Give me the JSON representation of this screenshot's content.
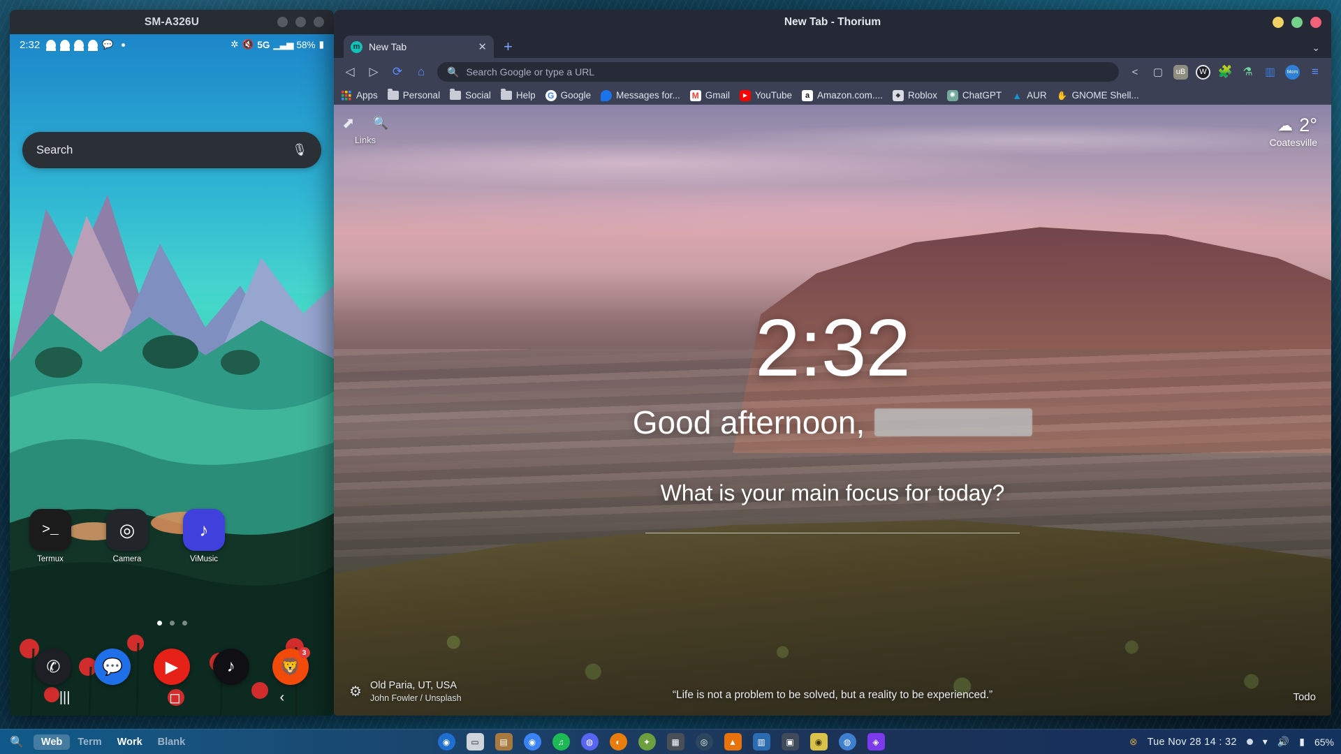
{
  "phone": {
    "window_title": "SM-A326U",
    "status_bar": {
      "time": "2:32",
      "notif_icons": [
        "ghost-icon",
        "ghost-icon",
        "ghost-icon",
        "ghost-icon",
        "chat-icon"
      ],
      "bluetooth": "bluetooth-icon",
      "mute": "ringer-off-icon",
      "network": "5G",
      "signal": "signal-bars-icon",
      "battery": "58%",
      "battery_icon": "battery-icon"
    },
    "search": {
      "placeholder": "Search",
      "mic_icon": "microphone-icon"
    },
    "apps": [
      {
        "label": "Termux",
        "icon": ">_",
        "color": "#1b1b1b"
      },
      {
        "label": "Camera",
        "icon": "◎",
        "color": "#22262b"
      },
      {
        "label": "ViMusic",
        "icon": "♪",
        "color": "#3f3fd6"
      }
    ],
    "page_dots": {
      "count": 3,
      "active_index": 0
    },
    "dock": [
      {
        "name": "phone",
        "icon": "✆",
        "color": "#1d1f24",
        "badge": ""
      },
      {
        "name": "messages",
        "icon": "💬",
        "color": "#1f6fe8",
        "badge": ""
      },
      {
        "name": "youtube",
        "icon": "▶",
        "color": "#e62117",
        "badge": ""
      },
      {
        "name": "tiktok",
        "icon": "♪",
        "color": "#101014",
        "badge": ""
      },
      {
        "name": "brave",
        "icon": "🦁",
        "color": "#f24a0a",
        "badge": "3"
      }
    ],
    "nav": {
      "recents": "|||",
      "home": "◻",
      "back": "‹"
    }
  },
  "browser": {
    "window_title": "New Tab - Thorium",
    "window_buttons": {
      "minimize": "#f0d264",
      "maximize": "#74d38a",
      "close": "#f2607a"
    },
    "tabs": [
      {
        "favicon_letter": "m",
        "title": "New Tab",
        "close": "✕"
      }
    ],
    "new_tab_button": "+",
    "tab_list_chevron": "⌄",
    "toolbar": {
      "back": "◁",
      "forward": "▷",
      "reload": "⟳",
      "home": "⌂",
      "omnibox_placeholder": "Search Google or type a URL",
      "search_icon": "search-icon",
      "share": "share-icon",
      "bookmark": "bookmark-icon",
      "extensions": [
        "ublock-origin",
        "wikiwand",
        "puzzle-extension",
        "flask-extension",
        "sidepanel",
        "momentum"
      ],
      "menu": "≡"
    },
    "bookmarks": [
      {
        "label": "Apps",
        "icon_kind": "grid"
      },
      {
        "label": "Personal",
        "icon_kind": "folder"
      },
      {
        "label": "Social",
        "icon_kind": "folder"
      },
      {
        "label": "Help",
        "icon_kind": "folder"
      },
      {
        "label": "Google",
        "icon_kind": "google"
      },
      {
        "label": "Messages for...",
        "icon_kind": "messages"
      },
      {
        "label": "Gmail",
        "icon_kind": "gmail"
      },
      {
        "label": "YouTube",
        "icon_kind": "youtube"
      },
      {
        "label": "Amazon.com....",
        "icon_kind": "amazon"
      },
      {
        "label": "Roblox",
        "icon_kind": "roblox"
      },
      {
        "label": "ChatGPT",
        "icon_kind": "chatgpt"
      },
      {
        "label": "AUR",
        "icon_kind": "arch"
      },
      {
        "label": "GNOME Shell...",
        "icon_kind": "gnome"
      }
    ],
    "newtab": {
      "links_label": "Links",
      "links_icon": "external-link-icon",
      "search_icon": "search-icon",
      "weather": {
        "temp": "2°",
        "city": "Coatesville",
        "icon": "cloud-snow-icon"
      },
      "clock": "2:32",
      "greeting": "Good afternoon,",
      "name_redacted": true,
      "focus_question": "What is your main focus for today?",
      "photo_location": "Old Paria, UT, USA",
      "photo_author": "John Fowler / Unsplash",
      "settings_icon": "gear-icon",
      "quote": "“Life is not a problem to be solved, but a reality to be experienced.”",
      "todo_label": "Todo"
    }
  },
  "taskbar": {
    "search_icon": "search-icon",
    "workspaces": [
      {
        "label": "Web",
        "state": "active"
      },
      {
        "label": "Term",
        "state": "dim"
      },
      {
        "label": "Work",
        "state": "lit"
      },
      {
        "label": "Blank",
        "state": "dim"
      }
    ],
    "apps": [
      {
        "name": "thorium",
        "glyph": "◉",
        "color": "#1f6fd0"
      },
      {
        "name": "terminal",
        "glyph": "▭",
        "color": "#cfd4da"
      },
      {
        "name": "files",
        "glyph": "▤",
        "color": "#a8793f"
      },
      {
        "name": "chromium",
        "glyph": "◉",
        "color": "#3b82f6"
      },
      {
        "name": "spotify",
        "glyph": "♫",
        "color": "#1db954"
      },
      {
        "name": "vesktop",
        "glyph": "◍",
        "color": "#5865f2"
      },
      {
        "name": "blender",
        "glyph": "◐",
        "color": "#e87d0d"
      },
      {
        "name": "gimp",
        "glyph": "✦",
        "color": "#6d9e3f"
      },
      {
        "name": "retroarch",
        "glyph": "▦",
        "color": "#4a4f57"
      },
      {
        "name": "steam",
        "glyph": "◎",
        "color": "#2a475e"
      },
      {
        "name": "vlc",
        "glyph": "▲",
        "color": "#e8720c"
      },
      {
        "name": "libreoffice-calc",
        "glyph": "▥",
        "color": "#2b6cb0"
      },
      {
        "name": "calculator",
        "glyph": "▣",
        "color": "#2f855a"
      },
      {
        "name": "lightbulb",
        "glyph": "◉",
        "color": "#d9c34a"
      },
      {
        "name": "vivaldi",
        "glyph": "◍",
        "color": "#3f7fd0"
      },
      {
        "name": "obsidian",
        "glyph": "◈",
        "color": "#7c3aed"
      }
    ],
    "tray": {
      "update_icon": "update-icon",
      "clock": "Tue Nov 28  14 : 32",
      "record_dot": "●",
      "wifi_icon": "wifi-icon",
      "volume_icon": "volume-icon",
      "battery_icon": "battery-icon",
      "battery_pct": "65%"
    }
  }
}
